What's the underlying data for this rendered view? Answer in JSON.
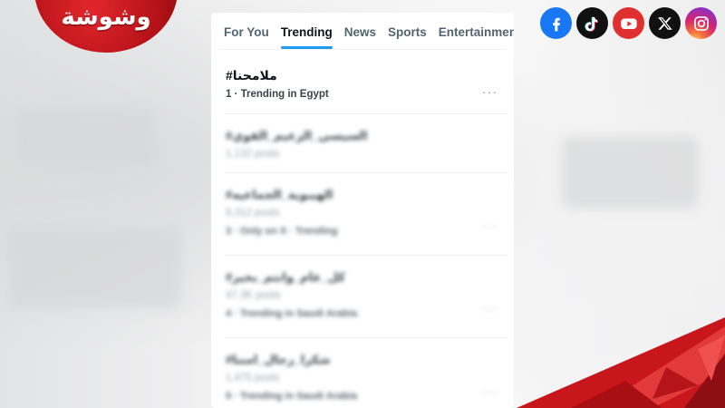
{
  "brand": {
    "name": "وشوشة",
    "color": "#c8161d"
  },
  "socials": [
    {
      "name": "facebook-icon",
      "color": "#1877f2"
    },
    {
      "name": "tiktok-icon",
      "color": "#111111"
    },
    {
      "name": "youtube-icon",
      "color": "#e02f2f"
    },
    {
      "name": "x-icon",
      "color": "#111111"
    },
    {
      "name": "instagram-icon",
      "color": "#d6246e"
    }
  ],
  "tabs": [
    {
      "label": "For You",
      "active": false
    },
    {
      "label": "Trending",
      "active": true
    },
    {
      "label": "News",
      "active": false
    },
    {
      "label": "Sports",
      "active": false
    },
    {
      "label": "Entertainment",
      "active": false
    }
  ],
  "accent": "#1d9bf0",
  "trends": [
    {
      "title": "#ملامحنا",
      "posts": "",
      "meta": "1 · Trending in Egypt",
      "more": "···"
    },
    {
      "title": "#السيسي_الزعيم_القوي",
      "posts": "1,132 posts",
      "meta": "",
      "more": ""
    },
    {
      "title": "#الهيبوية_الجماعيه",
      "posts": "6,312 posts",
      "meta": "3 · Only on X · Trending",
      "more": "···"
    },
    {
      "title": "#كل_عام_وانتم_بخير",
      "posts": "47.3K posts",
      "meta": "4 · Trending in Saudi Arabia",
      "more": "···"
    },
    {
      "title": "#شكرا_رجال_امننا",
      "posts": "1,475 posts",
      "meta": "5 · Trending in Saudi Arabia",
      "more": "···"
    }
  ]
}
